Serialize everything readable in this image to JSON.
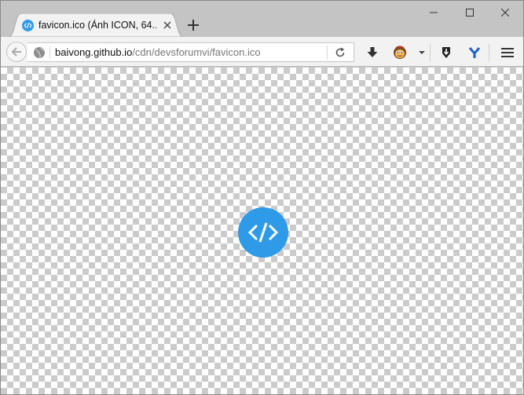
{
  "tab": {
    "title": "favicon.ico (Ảnh ICON, 64..."
  },
  "address_bar": {
    "host": "baivong.github.io",
    "path": "/cdn/devsforumvi/favicon.ico"
  },
  "colors": {
    "favicon_blue": "#2f9ae8",
    "chrome_gray": "#c4c4c4",
    "toolbar_bg": "#f2f2f2"
  },
  "icons": {
    "minimize": "minimize-icon",
    "maximize": "maximize-icon",
    "close": "close-icon",
    "back": "back-arrow-icon",
    "site_identity": "globe-icon",
    "reload": "reload-icon",
    "downloads": "download-icon",
    "extension_1": "monkey-icon",
    "menu_dropdown": "dropdown-arrow-icon",
    "extension_2": "shield-download-icon",
    "extension_3": "y-logo-icon",
    "hamburger": "hamburger-menu-icon",
    "image": "code-brackets-icon"
  }
}
